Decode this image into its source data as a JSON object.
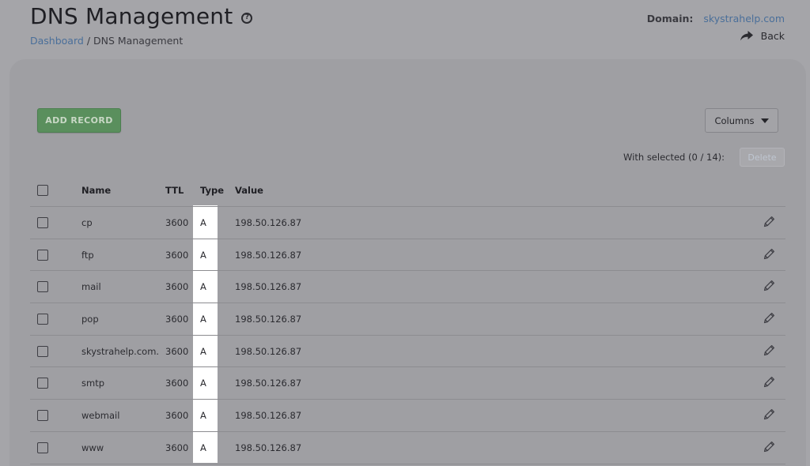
{
  "header": {
    "title": "DNS Management",
    "help_icon": "?",
    "breadcrumb": {
      "home": "Dashboard",
      "separator": "/",
      "current": "DNS Management"
    },
    "domain_label": "Domain:",
    "domain_value": "skystrahelp.com",
    "back_label": "Back"
  },
  "toolbar": {
    "add_record_label": "ADD RECORD",
    "columns_label": "Columns",
    "with_selected_label": "With selected (0 / 14):",
    "delete_label": "Delete"
  },
  "table": {
    "columns": {
      "name": "Name",
      "ttl": "TTL",
      "type": "Type",
      "value": "Value"
    },
    "rows": [
      {
        "name": "cp",
        "ttl": "3600",
        "type": "A",
        "value": "198.50.126.87"
      },
      {
        "name": "ftp",
        "ttl": "3600",
        "type": "A",
        "value": "198.50.126.87"
      },
      {
        "name": "mail",
        "ttl": "3600",
        "type": "A",
        "value": "198.50.126.87"
      },
      {
        "name": "pop",
        "ttl": "3600",
        "type": "A",
        "value": "198.50.126.87"
      },
      {
        "name": "skystrahelp.com.",
        "ttl": "3600",
        "type": "A",
        "value": "198.50.126.87"
      },
      {
        "name": "smtp",
        "ttl": "3600",
        "type": "A",
        "value": "198.50.126.87"
      },
      {
        "name": "webmail",
        "ttl": "3600",
        "type": "A",
        "value": "198.50.126.87"
      },
      {
        "name": "www",
        "ttl": "3600",
        "type": "A",
        "value": "198.50.126.87"
      }
    ]
  },
  "colors": {
    "overlay_background": "#a5a5a9",
    "panel_background": "#9f9fa3",
    "accent_link": "#4a6f9a",
    "add_button": "#5a8f5d",
    "type_column_highlight": "#ffffff"
  },
  "icons": {
    "help": "help-circle-icon",
    "back": "share-arrow-icon",
    "columns_caret": "caret-down-icon",
    "row_edit": "pencil-icon"
  }
}
